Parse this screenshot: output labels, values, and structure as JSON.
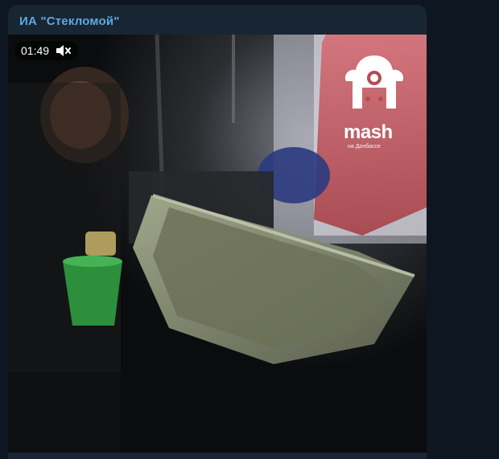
{
  "post": {
    "channel_name": "ИА \"Стекломой\""
  },
  "video": {
    "current_time": "01:49",
    "muted": true,
    "mute_icon": "volume-muted-icon",
    "progress": 0.04,
    "logo": {
      "brand": "mash",
      "sub": "на Донбассе",
      "color": "#ffffff"
    }
  },
  "colors": {
    "channel_name": "#5fa8e0",
    "progress_fill": "#5a9bd4",
    "progress_track": "#cfd6dd",
    "background": "#0e1621",
    "bubble": "#182533"
  }
}
